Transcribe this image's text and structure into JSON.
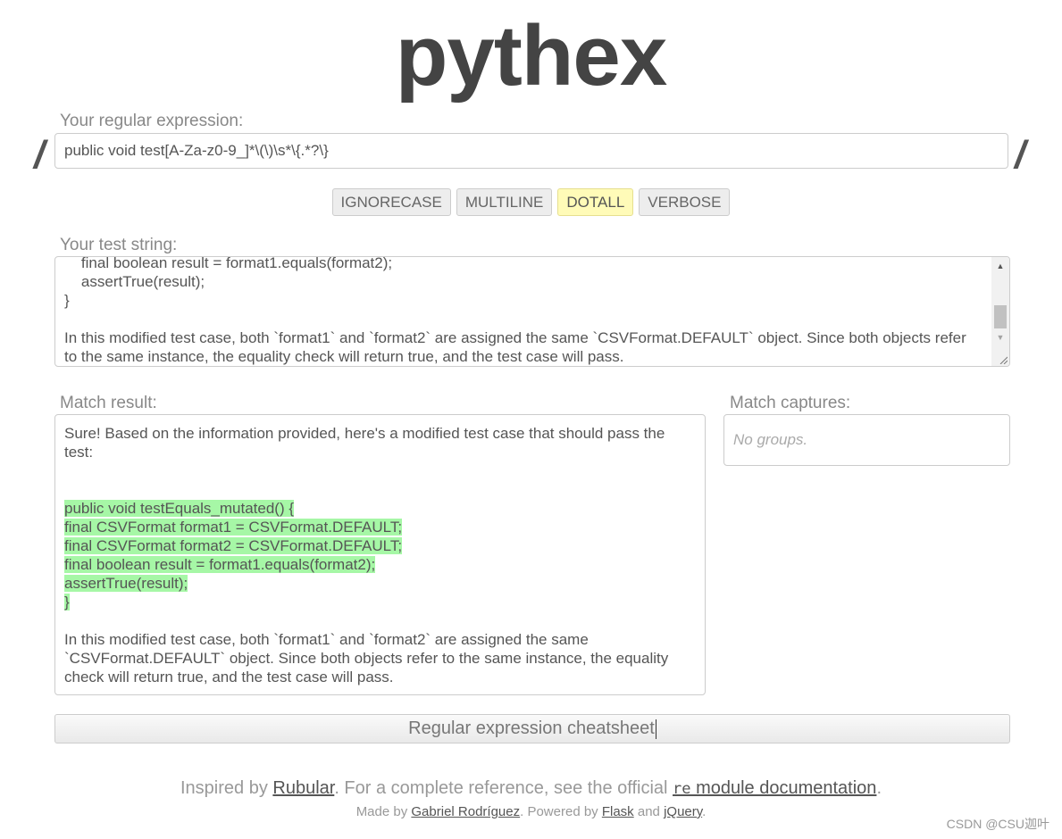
{
  "app": {
    "logo": "pythex"
  },
  "regex": {
    "label": "Your regular expression:",
    "delimiter": "/",
    "value": "public void test[A-Za-z0-9_]*\\(\\)\\s*\\{.*?\\}"
  },
  "flags": [
    {
      "label": "IGNORECASE",
      "active": false
    },
    {
      "label": "MULTILINE",
      "active": false
    },
    {
      "label": "DOTALL",
      "active": true
    },
    {
      "label": "VERBOSE",
      "active": false
    }
  ],
  "test_string": {
    "label": "Your test string:",
    "visible_text": "    final boolean result = format1.equals(format2);\n    assertTrue(result);\n}\n\nIn this modified test case, both `format1` and `format2` are assigned the same `CSVFormat.DEFAULT` object. Since both objects refer to the same instance, the equality check will return true, and the test case will pass."
  },
  "match_result": {
    "label": "Match result:",
    "intro": "Sure! Based on the information provided, here's a modified test case that should pass the test:",
    "matched_lines": [
      "public void testEquals_mutated() {",
      "final CSVFormat format1 = CSVFormat.DEFAULT;",
      "final CSVFormat format2 = CSVFormat.DEFAULT;",
      "final boolean result = format1.equals(format2);",
      "assertTrue(result);",
      "}"
    ],
    "outro": "In this modified test case, both `format1` and `format2` are assigned the same `CSVFormat.DEFAULT` object. Since both objects refer to the same instance, the equality check will return true, and the test case will pass."
  },
  "captures": {
    "label": "Match captures:",
    "empty_text": "No groups."
  },
  "cheatsheet": {
    "label": "Regular expression cheatsheet"
  },
  "footer": {
    "inspired_prefix": "Inspired by ",
    "rubular": "Rubular",
    "reference_text": ". For a complete reference, see the official ",
    "re_code": "re",
    "module_docs": " module documentation",
    "period": ".",
    "made_by_prefix": "Made by ",
    "author": "Gabriel Rodríguez",
    "powered_by": ". Powered by ",
    "flask": "Flask",
    "and": " and ",
    "jquery": "jQuery",
    "end": "."
  },
  "watermark": "CSDN @CSU迦叶",
  "colors": {
    "match_highlight": "#a6f7a6",
    "active_flag": "#fffbb8",
    "logo": "#444444"
  }
}
